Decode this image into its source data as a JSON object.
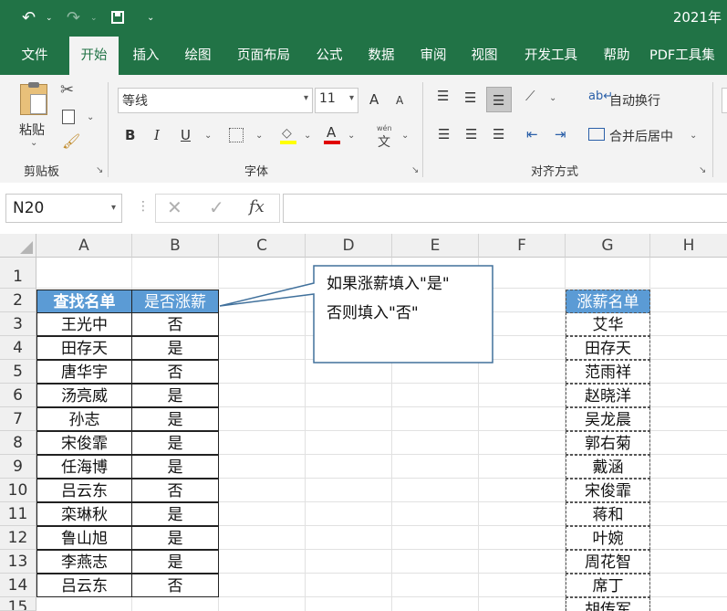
{
  "title_fragment": "2021年",
  "tabs": [
    "文件",
    "开始",
    "插入",
    "绘图",
    "页面布局",
    "公式",
    "数据",
    "审阅",
    "视图",
    "开发工具",
    "帮助",
    "PDF工具集"
  ],
  "ribbon": {
    "clipboard": {
      "paste": "粘贴",
      "label": "剪贴板"
    },
    "font": {
      "name": "等线",
      "size": "11",
      "label": "字体",
      "bold": "B",
      "italic": "I",
      "underline": "U",
      "grow": "A",
      "shrink": "A",
      "font_color": "A",
      "phonetic_top": "wén",
      "phonetic_char": "文"
    },
    "alignment": {
      "wrap": "自动换行",
      "merge": "合并后居中",
      "label": "对齐方式"
    }
  },
  "formula_bar": {
    "name_box": "N20",
    "fx": "fx",
    "value": ""
  },
  "columns": [
    "A",
    "B",
    "C",
    "D",
    "E",
    "F",
    "G",
    "H"
  ],
  "rows": [
    "1",
    "2",
    "3",
    "4",
    "5",
    "6",
    "7",
    "8",
    "9",
    "10",
    "11",
    "12",
    "13",
    "14",
    "15"
  ],
  "table_ab": {
    "headers": [
      "查找名单",
      "是否涨薪"
    ],
    "rows": [
      [
        "王光中",
        "否"
      ],
      [
        "田存天",
        "是"
      ],
      [
        "唐华宇",
        "否"
      ],
      [
        "汤亮威",
        "是"
      ],
      [
        "孙志",
        "是"
      ],
      [
        "宋俊霏",
        "是"
      ],
      [
        "任海博",
        "是"
      ],
      [
        "吕云东",
        "否"
      ],
      [
        "栾琳秋",
        "是"
      ],
      [
        "鲁山旭",
        "是"
      ],
      [
        "李燕志",
        "是"
      ],
      [
        "吕云东",
        "否"
      ]
    ]
  },
  "callout": {
    "line1": "如果涨薪填入\"是\"",
    "line2": "否则填入\"否\""
  },
  "table_g": {
    "header": "涨薪名单",
    "rows": [
      "艾华",
      "田存天",
      "范雨祥",
      "赵晓洋",
      "吴龙晨",
      "郭右菊",
      "戴涵",
      "宋俊霏",
      "蒋和",
      "叶婉",
      "周花智",
      "席丁",
      "胡传军"
    ]
  },
  "colors": {
    "excel_green": "#217346",
    "header_blue": "#5b9bd5",
    "callout_border": "#41719c"
  }
}
